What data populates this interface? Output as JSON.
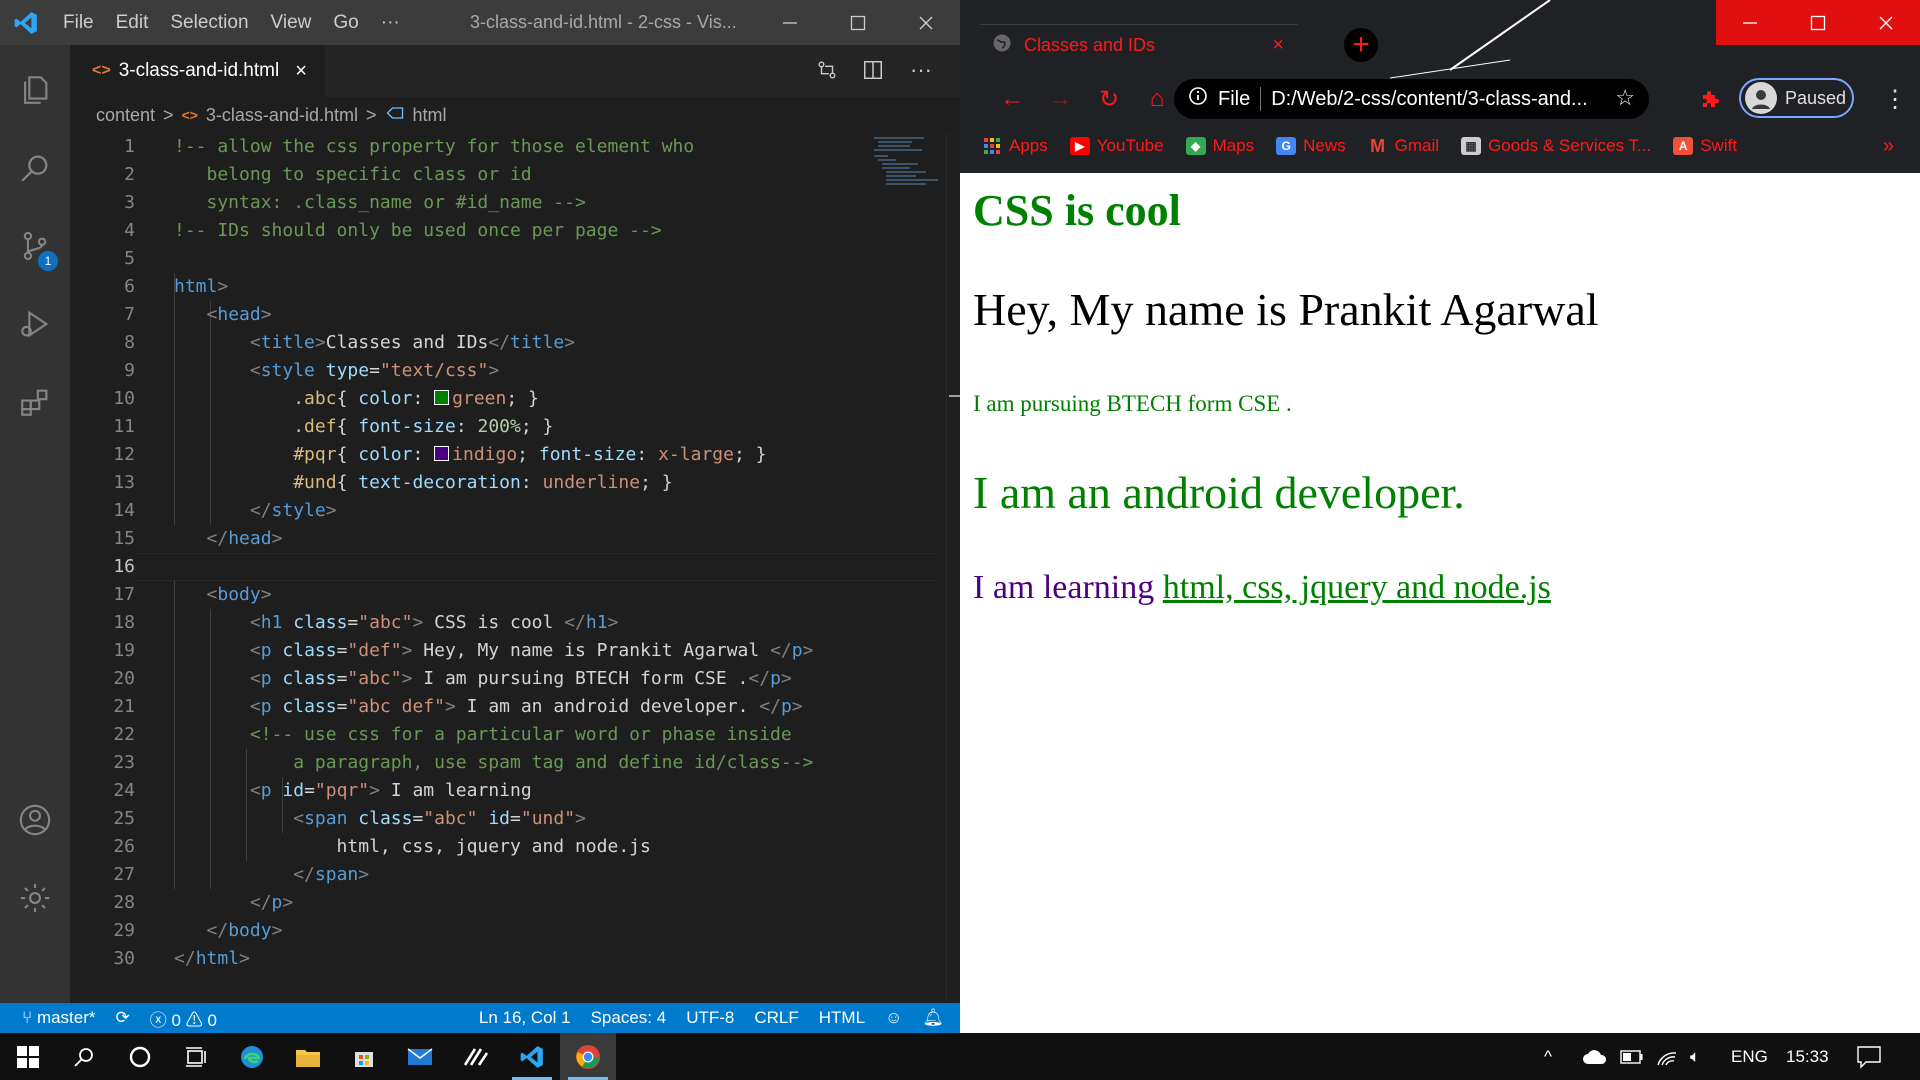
{
  "vscode": {
    "menu": [
      "File",
      "Edit",
      "Selection",
      "View",
      "Go",
      "···"
    ],
    "window_title": "3-class-and-id.html - 2-css - Vis...",
    "tab": {
      "icon": "<>",
      "label": "3-class-and-id.html",
      "close": "×"
    },
    "breadcrumb": {
      "folder": "content",
      "sep": ">",
      "file": "3-class-and-id.html",
      "node": "html"
    },
    "scm_badge": "1",
    "line_numbers": [
      "1",
      "2",
      "3",
      "4",
      "5",
      "6",
      "7",
      "8",
      "9",
      "10",
      "11",
      "12",
      "13",
      "14",
      "15",
      "16",
      "17",
      "18",
      "19",
      "20",
      "21",
      "22",
      "23",
      "24",
      "25",
      "26",
      "27",
      "28",
      "29",
      "30"
    ],
    "current_line": 16,
    "status": {
      "branch": "master*",
      "errors": "0",
      "warnings": "0",
      "position": "Ln 16, Col 1",
      "spaces": "Spaces: 4",
      "encoding": "UTF-8",
      "eol": "CRLF",
      "language": "HTML"
    }
  },
  "chrome": {
    "tab_title": "Classes and IDs",
    "tab_close": "×",
    "new_tab": "+",
    "url_scheme": "File",
    "url": "D:/Web/2-css/content/3-class-and...",
    "profile": "Paused",
    "bookmarks": [
      {
        "label": "Apps",
        "icon": "apps-icon",
        "color": "#ea4335"
      },
      {
        "label": "YouTube",
        "icon": "youtube-icon",
        "color": "#ff0000"
      },
      {
        "label": "Maps",
        "icon": "maps-icon",
        "color": "#34a853"
      },
      {
        "label": "News",
        "icon": "news-icon",
        "color": "#4285f4"
      },
      {
        "label": "Gmail",
        "icon": "gmail-icon",
        "color": "#ea4335"
      },
      {
        "label": "Goods & Services T...",
        "icon": "gst-icon",
        "color": "#888888"
      },
      {
        "label": "Swift",
        "icon": "swift-icon",
        "color": "#f05138"
      }
    ],
    "more": "»",
    "page": {
      "h1": "CSS is cool",
      "p1": "Hey, My name is Prankit Agarwal",
      "p2": "I am pursuing BTECH form CSE .",
      "p3": "I am an android developer.",
      "p4_prefix": "I am learning",
      "p4_span": "html, css, jquery and node.js"
    }
  },
  "taskbar": {
    "language": "ENG",
    "time": "15:33"
  },
  "colors": {
    "vscode_status": "#007acc",
    "chrome_accent": "#ff1a1a",
    "css_green": "#008000",
    "css_indigo": "#4b0082"
  }
}
